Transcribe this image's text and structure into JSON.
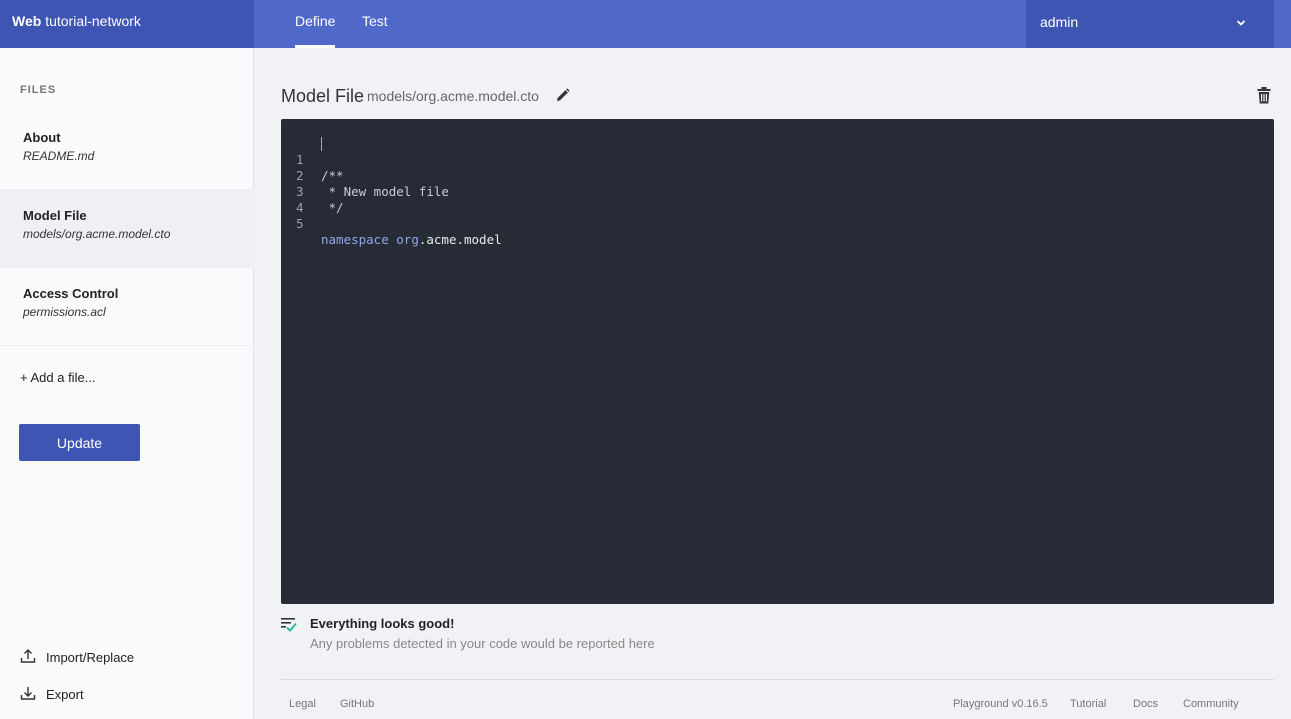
{
  "header": {
    "brand_bold": "Web",
    "brand_name": "tutorial-network",
    "tabs": [
      {
        "label": "Define",
        "active": true
      },
      {
        "label": "Test",
        "active": false
      }
    ],
    "user": "admin"
  },
  "sidebar": {
    "section_label": "FILES",
    "files": [
      {
        "name": "About",
        "path": "README.md",
        "selected": false
      },
      {
        "name": "Model File",
        "path": "models/org.acme.model.cto",
        "selected": true
      },
      {
        "name": "Access Control",
        "path": "permissions.acl",
        "selected": false
      }
    ],
    "add_file": "+ Add a file...",
    "update_button": "Update",
    "import_label": "Import/Replace",
    "export_label": "Export"
  },
  "main": {
    "title": "Model File",
    "path": "models/org.acme.model.cto",
    "editor": {
      "lines": [
        {
          "num": "1",
          "text": "/**"
        },
        {
          "num": "2",
          "text": " * New model file"
        },
        {
          "num": "3",
          "text": " */"
        },
        {
          "num": "4",
          "text": ""
        },
        {
          "num": "5",
          "keyword": "namespace",
          "namespace_org": "org",
          "namespace_rest": ".acme.model"
        }
      ]
    },
    "status": {
      "title": "Everything looks good!",
      "description": "Any problems detected in your code would be reported here"
    }
  },
  "footer": {
    "left_links": [
      "Legal",
      "GitHub"
    ],
    "version": "Playground v0.16.5",
    "right_links": [
      "Tutorial",
      "Docs",
      "Community"
    ]
  },
  "colors": {
    "accent": "#3f55b4",
    "topbar": "#5068c8",
    "editor_bg": "#272b36",
    "status_ok": "#2bb9a0"
  }
}
